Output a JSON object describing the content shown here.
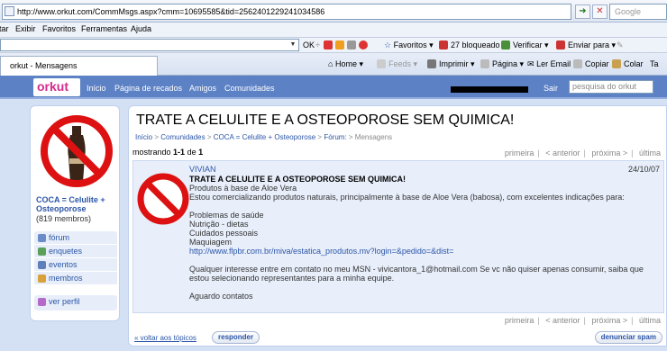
{
  "browser": {
    "url": "http://www.orkut.com/CommMsgs.aspx?cmm=10695585&tid=2562401229241034586",
    "search_placeholder": "Google",
    "menu": [
      "Editar",
      "Exibir",
      "Favoritos",
      "Ferramentas",
      "Ajuda"
    ],
    "toolbar": {
      "ok_label": "OK",
      "favoritos": "Favoritos",
      "bloqueado": "27 bloqueado",
      "verificar": "Verificar",
      "enviar": "Enviar para"
    },
    "tab_title": "orkut - Mensagens",
    "tab_tools": {
      "home": "Home",
      "feeds": "Feeds",
      "imprimir": "Imprimir",
      "pagina": "Página",
      "ler_email": "Ler Email",
      "copiar": "Copiar",
      "colar": "Colar",
      "ta": "Ta"
    }
  },
  "orkut": {
    "logo": "orkut",
    "nav": [
      "Início",
      "Página de recados",
      "Amigos",
      "Comunidades"
    ],
    "sair": "Sair",
    "search_placeholder": "pesquisa do orkut"
  },
  "community": {
    "name": "COCA = Celulite + Osteoporose",
    "members": "(819 membros)",
    "menu": [
      "fórum",
      "enquetes",
      "eventos",
      "membros"
    ],
    "profile": "ver perfil"
  },
  "topic": {
    "title": "TRATE A CELULITE E A OSTEOPOROSE SEM QUIMICA!",
    "breadcrumb": {
      "inicio": "Início",
      "comunidades": "Comunidades",
      "community": "COCA = Celulite + Osteoporose",
      "forum": "Fórum:",
      "current": "Mensagens",
      "sep": ">"
    },
    "showing_prefix": "mostrando",
    "showing_range": "1-1",
    "showing_of": "de",
    "showing_total": "1",
    "pager": {
      "first": "primeira",
      "prev": "< anterior",
      "next": "próxima >",
      "last": "última"
    }
  },
  "post": {
    "author": "VIVIAN",
    "date": "24/10/07",
    "subject": "TRATE A CELULITE E A OSTEOPOROSE SEM QUIMICA!",
    "line1": "Produtos à base de Aloe Vera",
    "line2": "Estou comercializando produtos naturais, principalmente à base de Aloe Vera (babosa), com excelentes indicações para:",
    "list": [
      "Problemas de saúde",
      "Nutrição - dietas",
      "Cuidados pessoais",
      "Maquiagem"
    ],
    "link": "http://www.flpbr.com.br/miva/estatica_produtos.mv?login=&pedido=&dist=",
    "contact": "Qualquer interesse entre em contato no meu MSN - vivicantora_1@hotmail.com Se vc não quiser apenas consumir, saiba que estou selecionando representantes para a minha equipe.",
    "closing": "Aguardo contatos"
  },
  "actions": {
    "back": "« voltar aos tópicos",
    "reply": "responder",
    "spam": "denunciar spam"
  }
}
